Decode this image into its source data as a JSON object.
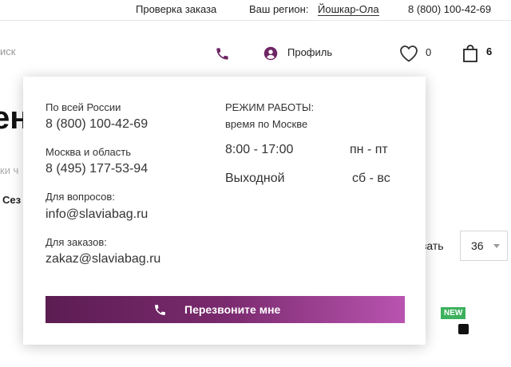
{
  "topbar": {
    "order_check": "Проверка заказа",
    "region_label": "Ваш регион:",
    "region_city": "Йошкар-Ола",
    "phone": "8 (800) 100-42-69"
  },
  "header": {
    "search_partial": "иск",
    "profile_label": "Профиль",
    "favorites_count": "0",
    "cart_count": "6"
  },
  "background": {
    "heading_partial": "ен",
    "filter_partial": "ки ч",
    "season_partial": "Сез",
    "show_label": "зать",
    "per_page_value": "36",
    "badge_new": "NEW"
  },
  "contact_popup": {
    "russia_label": "По всей России",
    "russia_phone": "8 (800) 100-42-69",
    "moscow_label": "Москва и область",
    "moscow_phone": "8 (495) 177-53-94",
    "questions_label": "Для вопросов:",
    "questions_email": "info@slaviabag.ru",
    "orders_label": "Для заказов:",
    "orders_email": "zakaz@slaviabag.ru",
    "schedule_title": "РЕЖИМ РАБОТЫ:",
    "schedule_subtitle": "время по Москве",
    "work_hours": "8:00 - 17:00",
    "work_days": "пн - пт",
    "day_off_label": "Выходной",
    "day_off_days": "сб - вс",
    "callback_button": "Перезвоните мне"
  },
  "icons": {
    "phone": "phone-icon",
    "profile": "user-circle-icon",
    "favorites": "heart-icon",
    "cart": "shopping-bag-icon"
  },
  "colors": {
    "brand_purple": "#6e2563",
    "button_gradient_start": "#5c1d52",
    "button_gradient_end": "#b954b0",
    "badge_green": "#3cb15d"
  }
}
